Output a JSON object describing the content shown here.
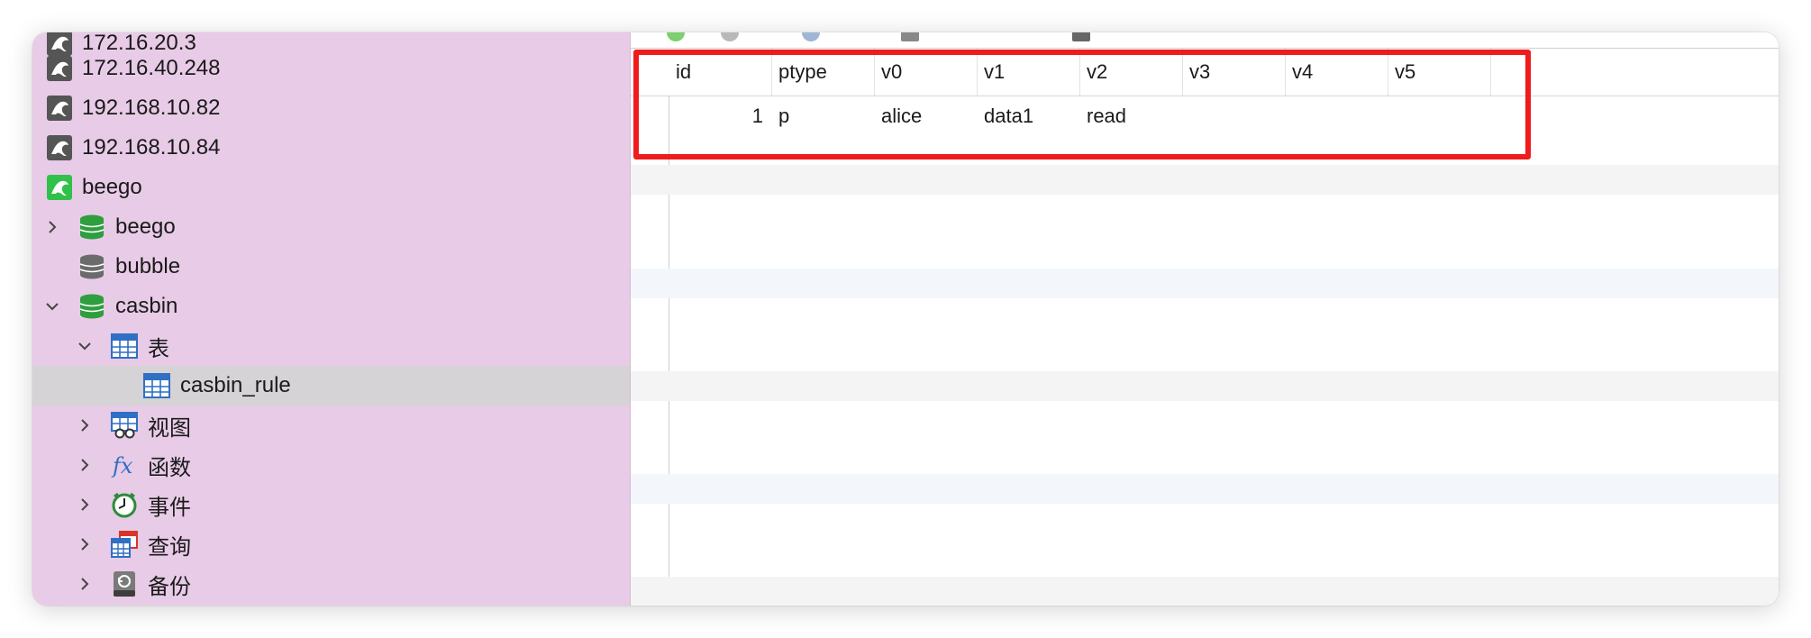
{
  "sidebar": {
    "connections": [
      {
        "label": "172.16.20.3",
        "icon": "mysql-connection-icon",
        "state": "closed"
      },
      {
        "label": "172.16.40.248",
        "icon": "mysql-connection-icon",
        "state": "closed"
      },
      {
        "label": "192.168.10.82",
        "icon": "mysql-connection-icon",
        "state": "closed"
      },
      {
        "label": "192.168.10.84",
        "icon": "mysql-connection-icon",
        "state": "closed"
      },
      {
        "label": "beego",
        "icon": "mysql-connection-icon",
        "state": "open"
      }
    ],
    "databases": [
      {
        "label": "beego",
        "icon": "database-icon",
        "state": "open",
        "expanded": false
      },
      {
        "label": "bubble",
        "icon": "database-icon",
        "state": "closed"
      },
      {
        "label": "casbin",
        "icon": "database-icon",
        "state": "open",
        "expanded": true
      }
    ],
    "casbin_groups": [
      {
        "label": "表",
        "icon": "table-group-icon",
        "expanded": true
      },
      {
        "label": "视图",
        "icon": "view-icon",
        "expanded": false
      },
      {
        "label": "函数",
        "icon": "function-icon",
        "expanded": false
      },
      {
        "label": "事件",
        "icon": "event-clock-icon",
        "expanded": false
      },
      {
        "label": "查询",
        "icon": "query-icon",
        "expanded": false
      },
      {
        "label": "备份",
        "icon": "backup-icon",
        "expanded": false
      }
    ],
    "tables": [
      {
        "label": "casbin_rule",
        "icon": "table-icon",
        "selected": true
      }
    ]
  },
  "grid": {
    "columns": [
      "id",
      "ptype",
      "v0",
      "v1",
      "v2",
      "v3",
      "v4",
      "v5"
    ],
    "rows": [
      {
        "id": "1",
        "ptype": "p",
        "v0": "alice",
        "v1": "data1",
        "v2": "read",
        "v3": "",
        "v4": "",
        "v5": ""
      }
    ]
  },
  "colors": {
    "sidebar_bg": "#e8cbe6",
    "selected_row": "#d6d3d6",
    "highlight": "#ee1c1c",
    "db_open": "#2e9e3e",
    "db_closed": "#6b6b6b",
    "conn_open": "#2fc149",
    "conn_closed": "#555555"
  }
}
